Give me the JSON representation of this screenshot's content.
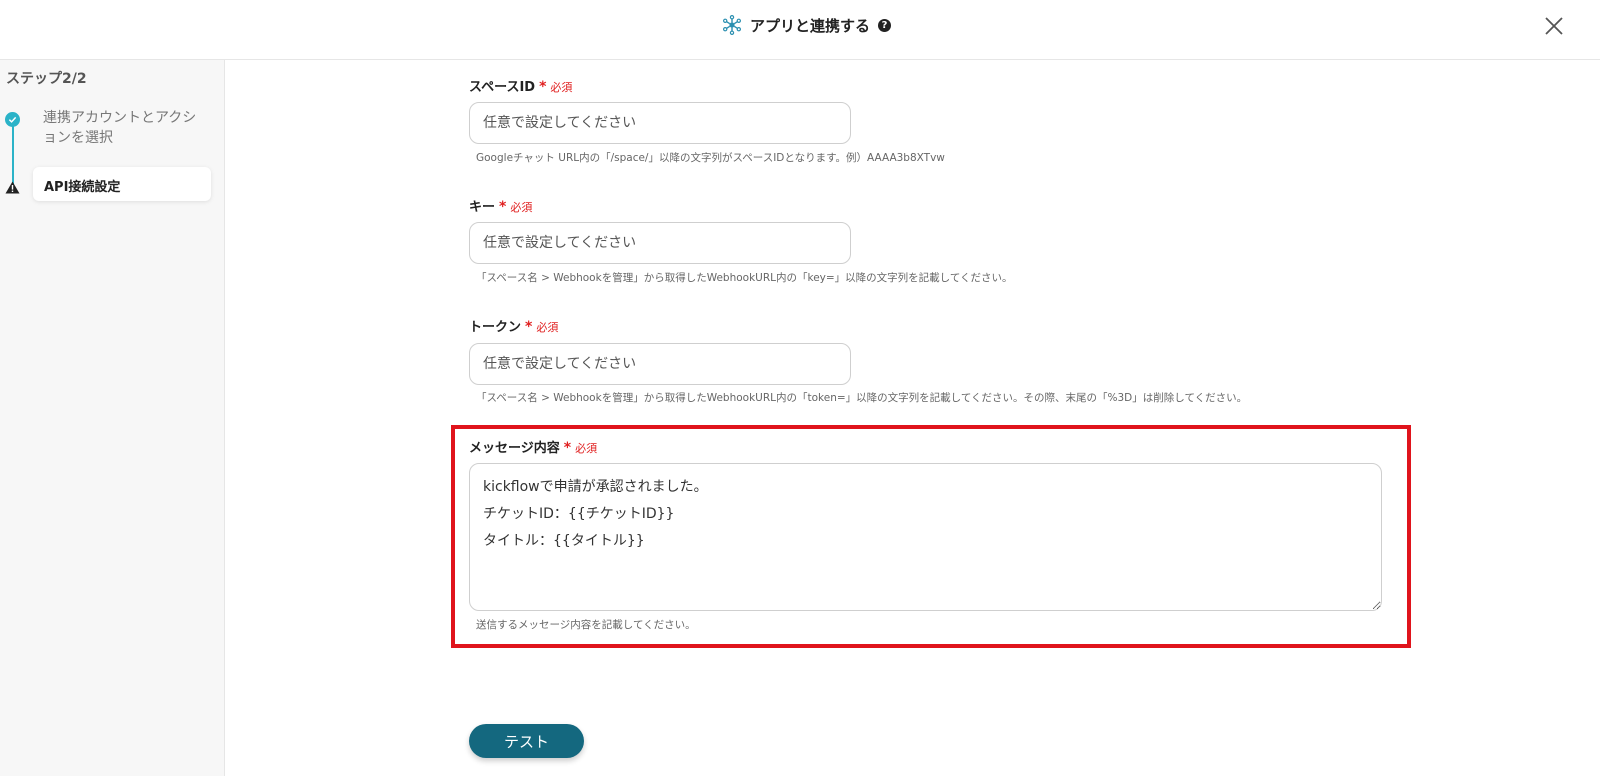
{
  "header": {
    "title": "アプリと連携する",
    "help": "?",
    "app_icon": "network-hub-icon",
    "close_icon": "close-icon"
  },
  "sidebar": {
    "step_label": "ステップ2/2",
    "steps": [
      {
        "label": "連携アカウントとアクションを選択",
        "status": "completed",
        "icon": "check-circle-icon"
      },
      {
        "label": "API接続設定",
        "status": "warning",
        "icon": "warning-triangle-icon"
      }
    ]
  },
  "form": {
    "required_label": "必須",
    "fields": [
      {
        "label": "スペースID",
        "placeholder": "任意で設定してください",
        "value": "",
        "help": "Googleチャット URL内の「/space/」以降の文字列がスペースIDとなります。例）AAAA3b8XTvw"
      },
      {
        "label": "キー",
        "placeholder": "任意で設定してください",
        "value": "",
        "help": "「スペース名 > Webhookを管理」から取得したWebhookURL内の「key=」以降の文字列を記載してください。"
      },
      {
        "label": "トークン",
        "placeholder": "任意で設定してください",
        "value": "",
        "help": "「スペース名 > Webhookを管理」から取得したWebhookURL内の「token=」以降の文字列を記載してください。その際、末尾の「%3D」は削除してください。"
      }
    ],
    "message": {
      "label": "メッセージ内容",
      "value": "kickflowで申請が承認されました。\nチケットID：{{チケットID}}\nタイトル：{{タイトル}}",
      "help": "送信するメッセージ内容を記載してください。"
    },
    "test_button": "テスト"
  },
  "colors": {
    "accent": "#2bb3c8",
    "primary_button": "#14687f",
    "required": "#e02020",
    "highlight": "#e0141c"
  }
}
